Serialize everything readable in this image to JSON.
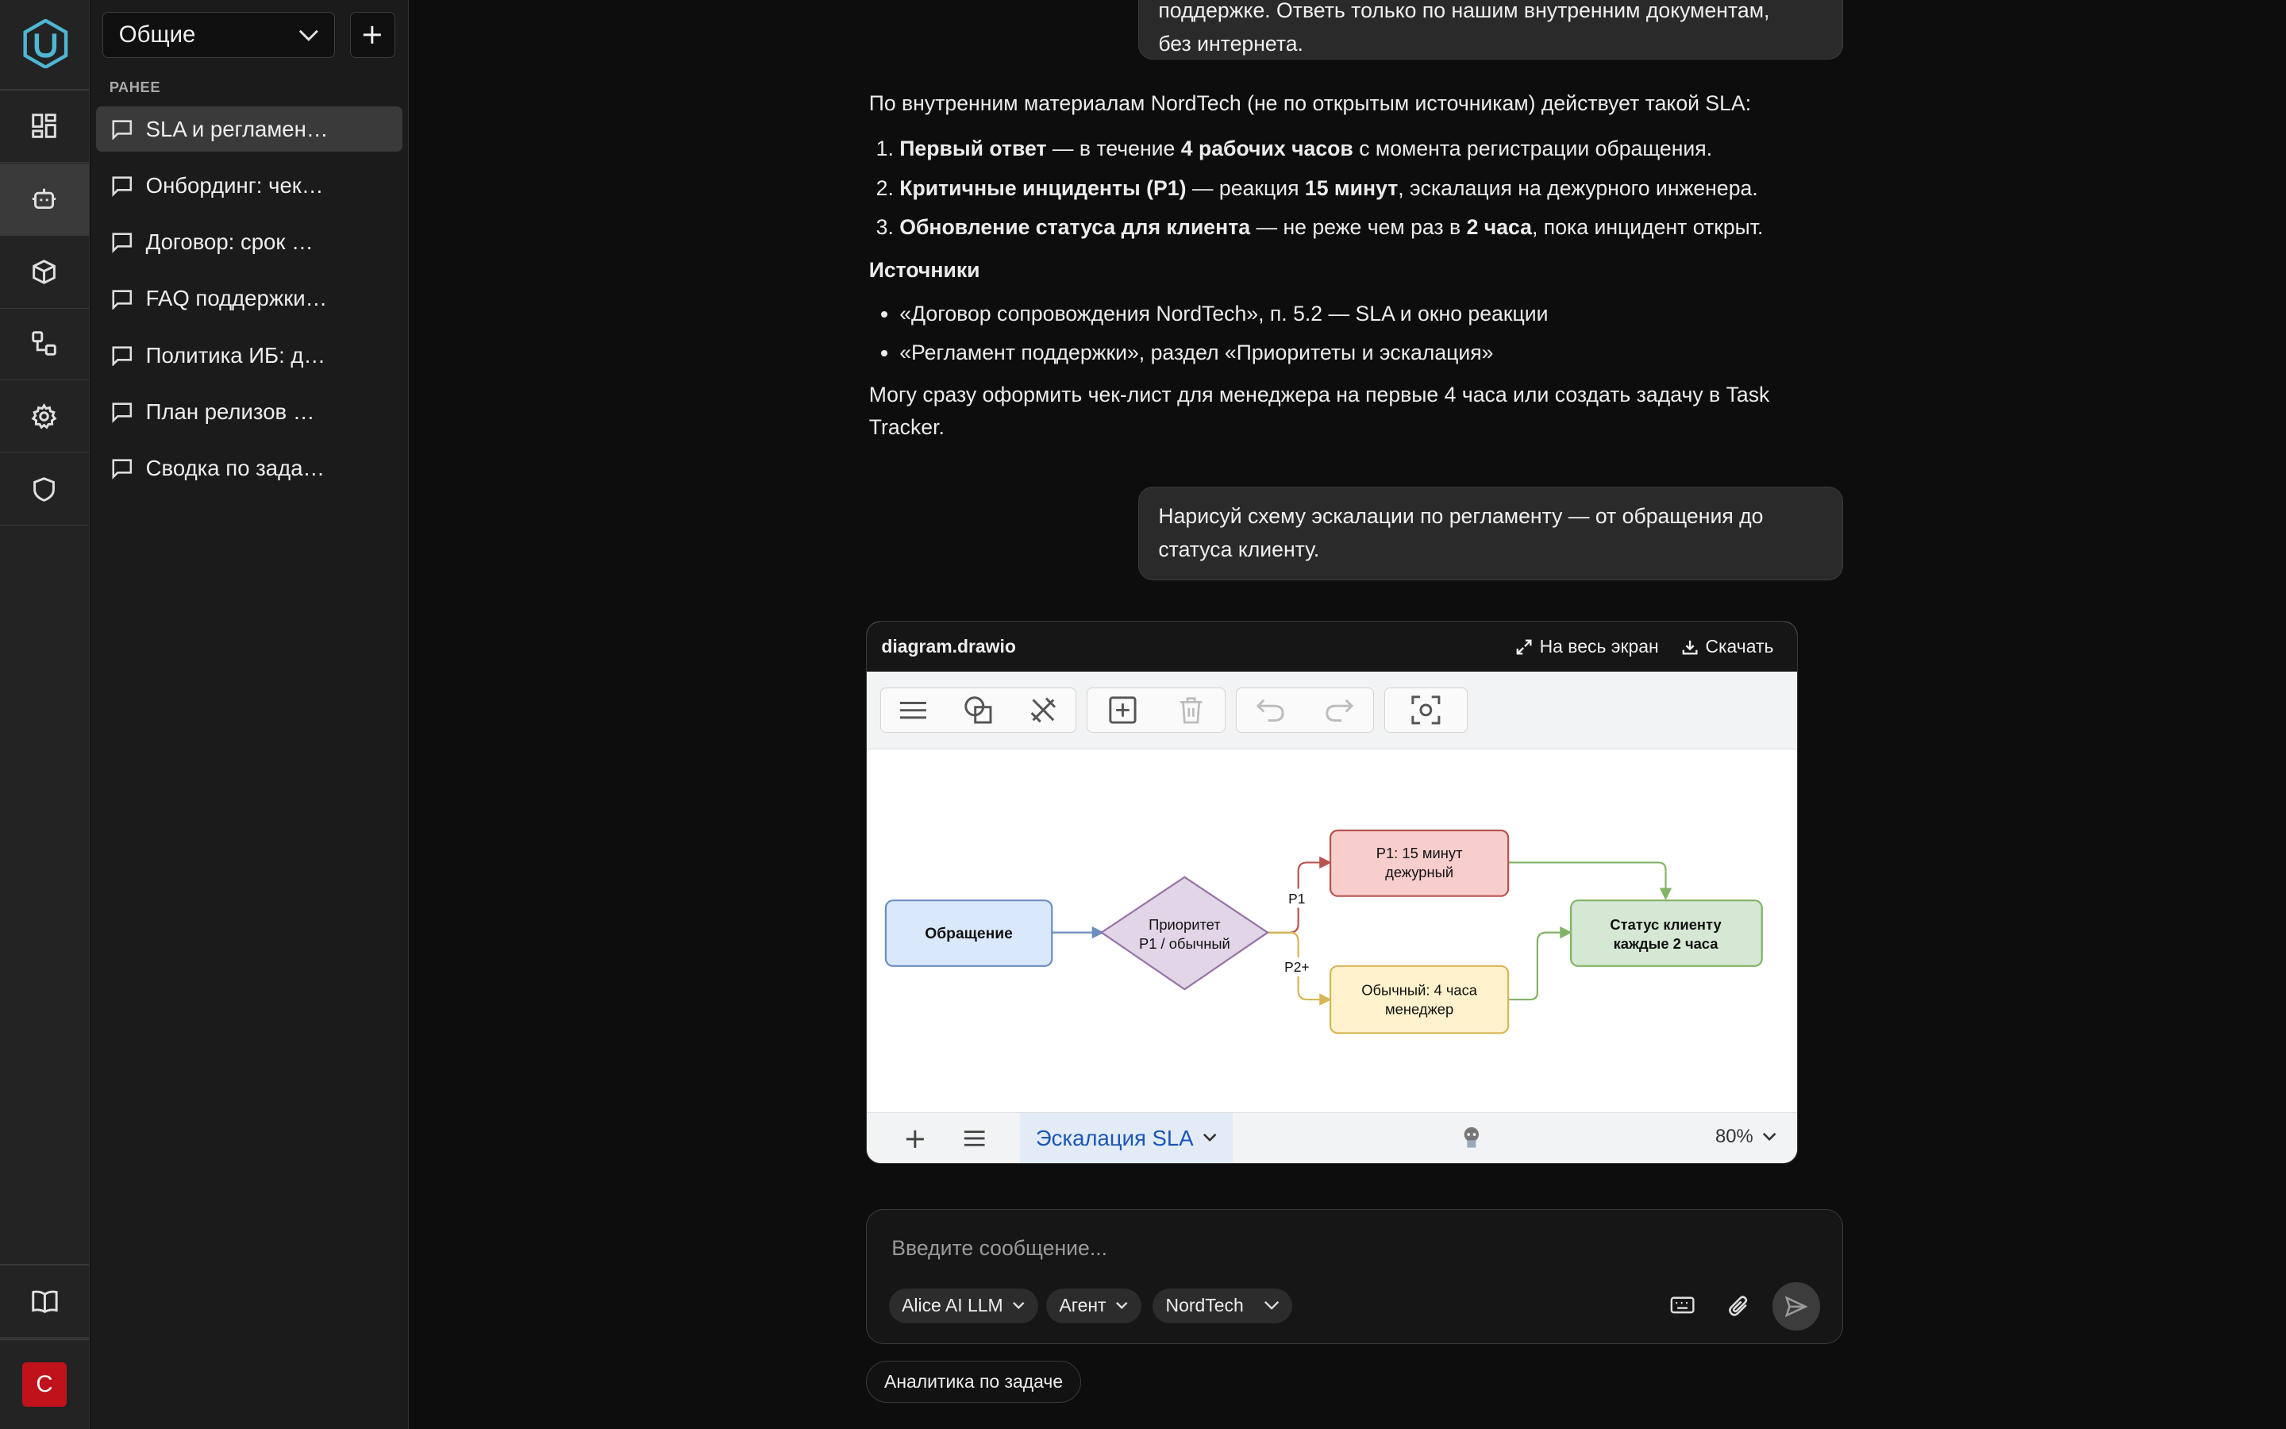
{
  "workspace": {
    "selected": "Общие"
  },
  "sidebar": {
    "section_label": "РАНЕЕ",
    "chats": [
      "SLA и регламен…",
      "Онбординг: чек…",
      "Договор: срок …",
      "FAQ поддержки…",
      "Политика ИБ: д…",
      "План релизов …",
      "Сводка по зада…"
    ]
  },
  "user": {
    "initial": "С"
  },
  "colors": {
    "accent": "#4fb6d3",
    "avatar": "#c0121b",
    "page_tab": "#1a56b8"
  },
  "messages": {
    "prev_user": {
      "line1": "поддержке. Ответь только по нашим внутренним документам,",
      "line2": "без интернета."
    },
    "assistant": {
      "intro": "По внутренним материалам NordTech (не по открытым источникам) действует такой SLA:",
      "items": [
        {
          "bold1": "Первый ответ",
          "t1": " — в течение ",
          "bold2": "4 рабочих часов",
          "t2": " с момента регистрации обращения."
        },
        {
          "bold1": "Критичные инциденты (P1)",
          "t1": " — реакция ",
          "bold2": "15 минут",
          "t2": ", эскалация на дежурного инженера."
        },
        {
          "bold1": "Обновление статуса для клиента",
          "t1": " — не реже чем раз в ",
          "bold2": "2 часа",
          "t2": ", пока инцидент открыт."
        }
      ],
      "sources_title": "Источники",
      "sources": [
        "«Договор сопровождения NordTech», п. 5.2 — SLA и окно реакции",
        "«Регламент поддержки», раздел «Приоритеты и эскалация»"
      ],
      "closing": "Могу сразу оформить чек-лист для менеджера на первые 4 часа или создать задачу в Task Tracker."
    },
    "user_request": "Нарисуй схему эскалации по регламенту — от обращения до статуса клиенту."
  },
  "diagram": {
    "filename": "diagram.drawio",
    "fullscreen_label": "На весь экран",
    "download_label": "Скачать",
    "page_name": "Эскалация SLA",
    "zoom": "80%",
    "nodes": {
      "request": "Обращение",
      "priority_l1": "Приоритет",
      "priority_l2": "P1 / обычный",
      "p1_l1": "P1: 15 минут",
      "p1_l2": "дежурный",
      "normal_l1": "Обычный: 4 часа",
      "normal_l2": "менеджер",
      "status_l1": "Статус клиенту",
      "status_l2": "каждые 2 часа"
    },
    "edge_labels": {
      "p1": "P1",
      "p2": "P2+"
    }
  },
  "composer": {
    "placeholder": "Введите сообщение...",
    "model": "Alice AI LLM",
    "mode": "Агент",
    "knowledge_base": "NordTech"
  },
  "suggestion": "Аналитика по задаче"
}
